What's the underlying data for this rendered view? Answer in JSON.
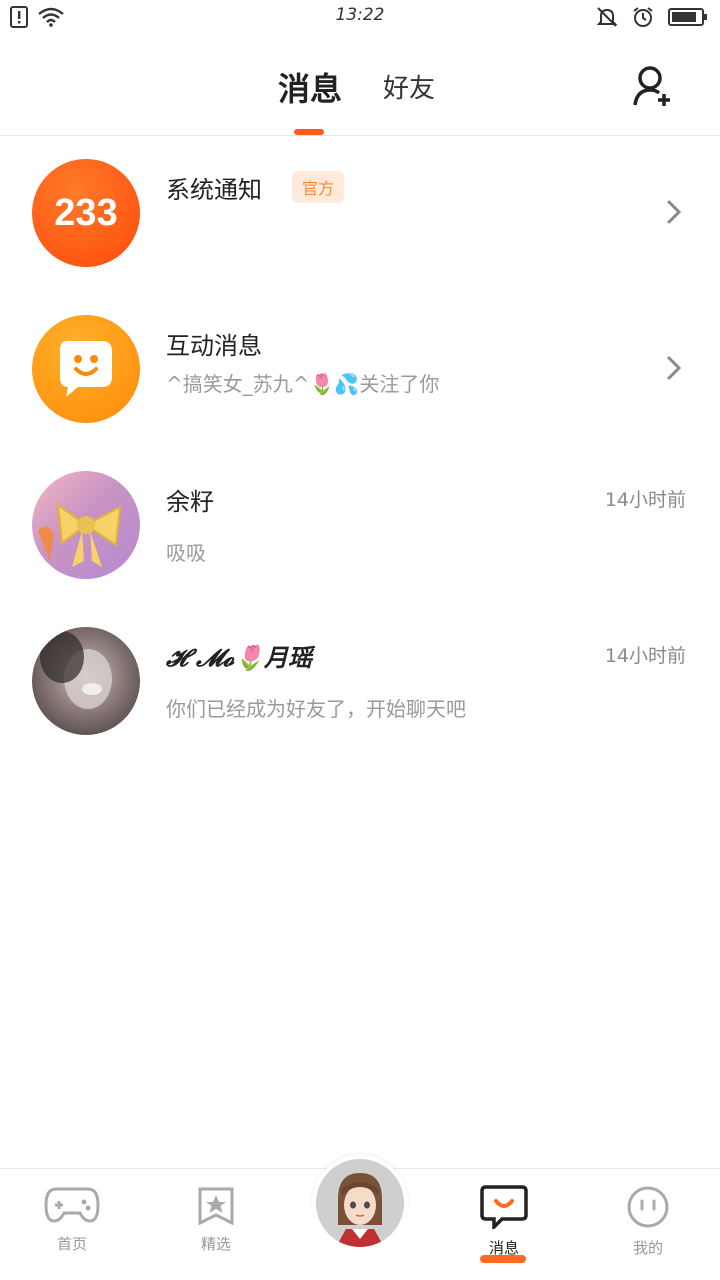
{
  "status_bar": {
    "time": "13:22"
  },
  "header": {
    "tab_messages": "消息",
    "tab_friends": "好友"
  },
  "list": [
    {
      "title": "系统通知",
      "badge": "官方",
      "subtitle": "",
      "time": ""
    },
    {
      "title": "互动消息",
      "subtitle": "^搞笑女_苏九^🌷💦关注了你",
      "time": ""
    },
    {
      "title": "余籽",
      "subtitle": "吸吸",
      "time": "14小时前"
    },
    {
      "title": "𝓗             𝓜𝓸🌷月瑶",
      "subtitle": "你们已经成为好友了，开始聊天吧",
      "time": "14小时前"
    }
  ],
  "avatar_233": "233",
  "bottom_nav": {
    "home": "首页",
    "featured": "精选",
    "messages": "消息",
    "me": "我的"
  },
  "colors": {
    "accent": "#ff5a1f"
  }
}
